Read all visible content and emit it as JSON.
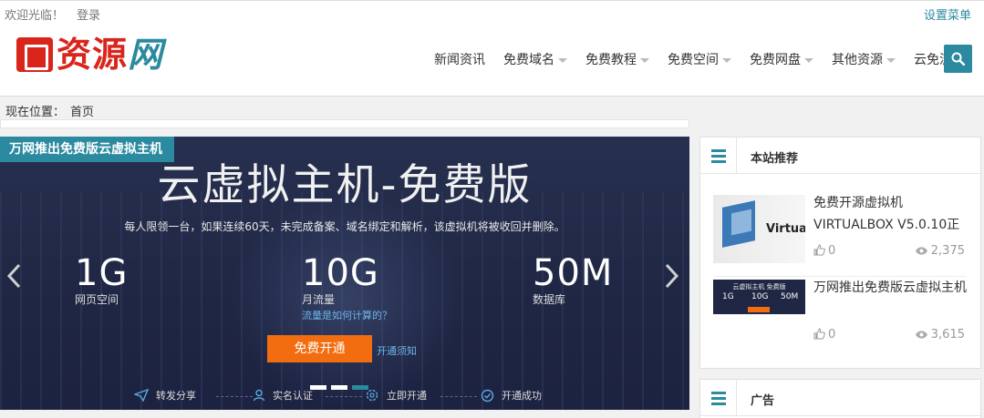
{
  "topbar": {
    "welcome": "欢迎光临！",
    "login": "登录",
    "settings": "设置菜单"
  },
  "logo": {
    "char1": "资",
    "char2": "源",
    "char3": "网"
  },
  "nav": {
    "items": [
      {
        "label": "新闻资讯",
        "dropdown": false
      },
      {
        "label": "免费域名",
        "dropdown": true
      },
      {
        "label": "免费教程",
        "dropdown": true
      },
      {
        "label": "免费空间",
        "dropdown": true
      },
      {
        "label": "免费网盘",
        "dropdown": true
      },
      {
        "label": "其他资源",
        "dropdown": true
      },
      {
        "label": "云免流",
        "dropdown": false
      }
    ]
  },
  "breadcrumb": {
    "label": "现在位置：",
    "home": "首页"
  },
  "slider": {
    "tag": "万网推出免费版云虚拟主机",
    "title": "云虚拟主机-免费版",
    "desc": "每人限领一台，如果连续60天，未完成备案、域名绑定和解析，该虚拟机将被收回并删除。",
    "stats": [
      {
        "num": "1G",
        "label": "网页空间",
        "sub": ""
      },
      {
        "num": "10G",
        "label": "月流量",
        "sub": "流量是如何计算的？"
      },
      {
        "num": "50M",
        "label": "数据库",
        "sub": ""
      }
    ],
    "button": "免费开通",
    "note": "开通须知",
    "steps": [
      "转发分享",
      "实名认证",
      "立即开通",
      "开通成功"
    ],
    "dots": 3,
    "active_dot": 2
  },
  "recommend": {
    "title": "本站推荐",
    "items": [
      {
        "title": "免费开源虚拟机VIRTUALBOX V5.0.10正",
        "thumb_text": "Virtual",
        "likes": "0",
        "views": "2,375"
      },
      {
        "title": "万网推出免费版云虚拟主机",
        "thumb_text": "云虚拟主机 免费版",
        "likes": "0",
        "views": "3,615"
      }
    ]
  },
  "ads": {
    "title": "广告"
  },
  "colors": {
    "accent": "#2b8aa0",
    "orange": "#f26d0f",
    "logo_red": "#d9251c"
  }
}
